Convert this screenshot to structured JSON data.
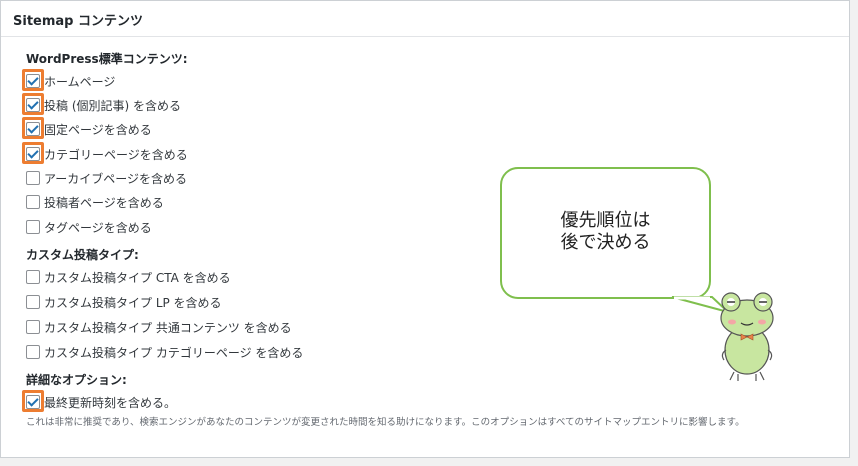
{
  "panel": {
    "title": "Sitemap コンテンツ"
  },
  "sections": {
    "standard": "WordPress標準コンテンツ:",
    "custom": "カスタム投稿タイプ:",
    "options": "詳細なオプション:"
  },
  "standard_items": [
    {
      "label": "ホームページ",
      "checked": true
    },
    {
      "label": "投稿 (個別記事) を含める",
      "checked": true
    },
    {
      "label": "固定ページを含める",
      "checked": true
    },
    {
      "label": "カテゴリーページを含める",
      "checked": true
    },
    {
      "label": "アーカイブページを含める",
      "checked": false
    },
    {
      "label": "投稿者ページを含める",
      "checked": false
    },
    {
      "label": "タグページを含める",
      "checked": false
    }
  ],
  "custom_items": [
    {
      "label": "カスタム投稿タイプ CTA を含める",
      "checked": false
    },
    {
      "label": "カスタム投稿タイプ LP を含める",
      "checked": false
    },
    {
      "label": "カスタム投稿タイプ 共通コンテンツ を含める",
      "checked": false
    },
    {
      "label": "カスタム投稿タイプ カテゴリーページ を含める",
      "checked": false
    }
  ],
  "options_items": [
    {
      "label": "最終更新時刻を含める。",
      "checked": true
    }
  ],
  "options_description": "これは非常に推奨であり、検索エンジンがあなたのコンテンツが変更された時間を知る助けになります。このオプションはすべてのサイトマップエントリに影響します。",
  "callout": {
    "line1": "優先順位は",
    "line2": "後で決める"
  },
  "colors": {
    "highlight": "#ed7d31",
    "bubble_border": "#7fbf4d",
    "check": "#2271b1"
  }
}
